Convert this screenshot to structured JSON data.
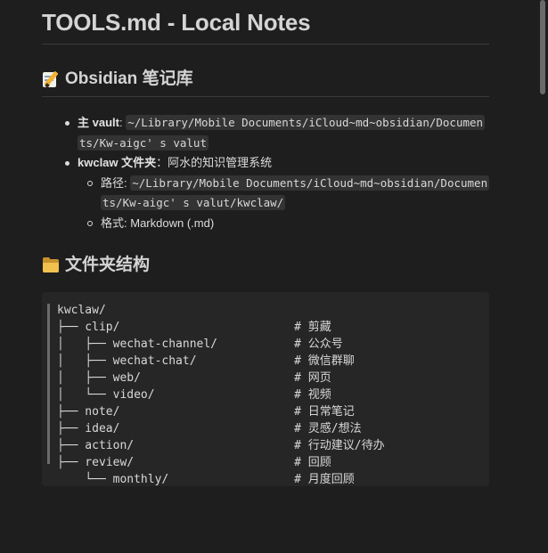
{
  "title": "TOOLS.md - Local Notes",
  "sections": {
    "obsidian": {
      "emoji": "memo-icon",
      "heading": "Obsidian 笔记库",
      "items": [
        {
          "label": "主 vault",
          "sep": ": ",
          "code": "~/Library/Mobile Documents/iCloud~md~obsidian/Documents/Kw-aigc' s valut"
        },
        {
          "label": "kwclaw 文件夹",
          "sep": "：",
          "text": "阿水的知识管理系统",
          "children": [
            {
              "label": "路径",
              "sep": ": ",
              "code": "~/Library/Mobile Documents/iCloud~md~obsidian/Documents/Kw-aigc' s valut/kwclaw/"
            },
            {
              "label": "格式",
              "sep": ": ",
              "text": "Markdown (.md)"
            }
          ]
        }
      ]
    },
    "folder": {
      "emoji": "folder-icon",
      "heading": "文件夹结构",
      "code": "kwclaw/\n├── clip/                         # 剪藏\n│   ├── wechat-channel/           # 公众号\n│   ├── wechat-chat/              # 微信群聊\n│   ├── web/                      # 网页\n│   └── video/                    # 视频\n├── note/                         # 日常笔记\n├── idea/                         # 灵感/想法\n├── action/                       # 行动建议/待办\n├── review/                       # 回顾\n    └── monthly/                  # 月度回顾"
    }
  },
  "colors": {
    "background": "#1e1e1e",
    "text": "#dcddde",
    "code_bg": "#262626",
    "inline_code_bg": "#333333"
  }
}
